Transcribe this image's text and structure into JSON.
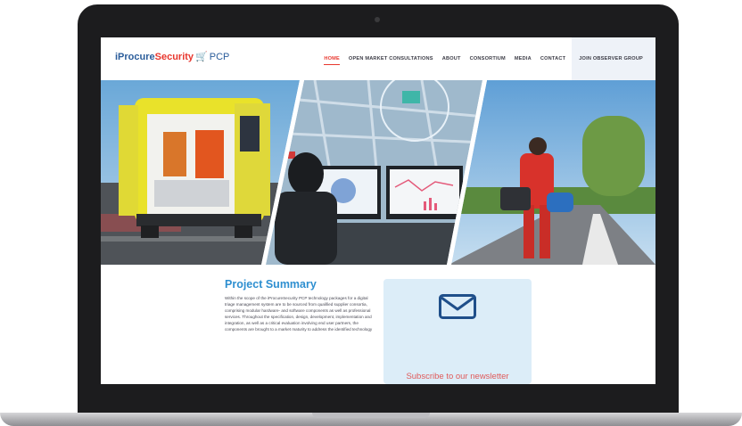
{
  "brand": {
    "logo_part1": "iProcure",
    "logo_part2": "Security",
    "logo_suffix": "PCP"
  },
  "nav": {
    "items": [
      {
        "label": "HOME",
        "active": true
      },
      {
        "label": "OPEN MARKET CONSULTATIONS"
      },
      {
        "label": "ABOUT"
      },
      {
        "label": "CONSORTIUM"
      },
      {
        "label": "MEDIA"
      },
      {
        "label": "CONTACT"
      },
      {
        "label": "JOIN OBSERVER GROUP"
      }
    ]
  },
  "summary": {
    "title": "Project Summary",
    "text": "Within the scope of the iProcureSecurity PCP technology packages for a digital triage management system are to be sourced from qualified supplier consortia, comprising modular hardware- and software components as well as professional services. Throughout the specification, design, development, implementation and integration, as well as a critical evaluation involving end user partners, the components are brought to a market maturity to address the identified technology"
  },
  "newsletter": {
    "label": "Subscribe to our newsletter",
    "icon": "envelope-icon"
  },
  "colors": {
    "brand_blue": "#2b5d9b",
    "brand_red": "#e8372e",
    "title_blue": "#2e8fd0",
    "newsletter_bg": "#dcedf8"
  }
}
